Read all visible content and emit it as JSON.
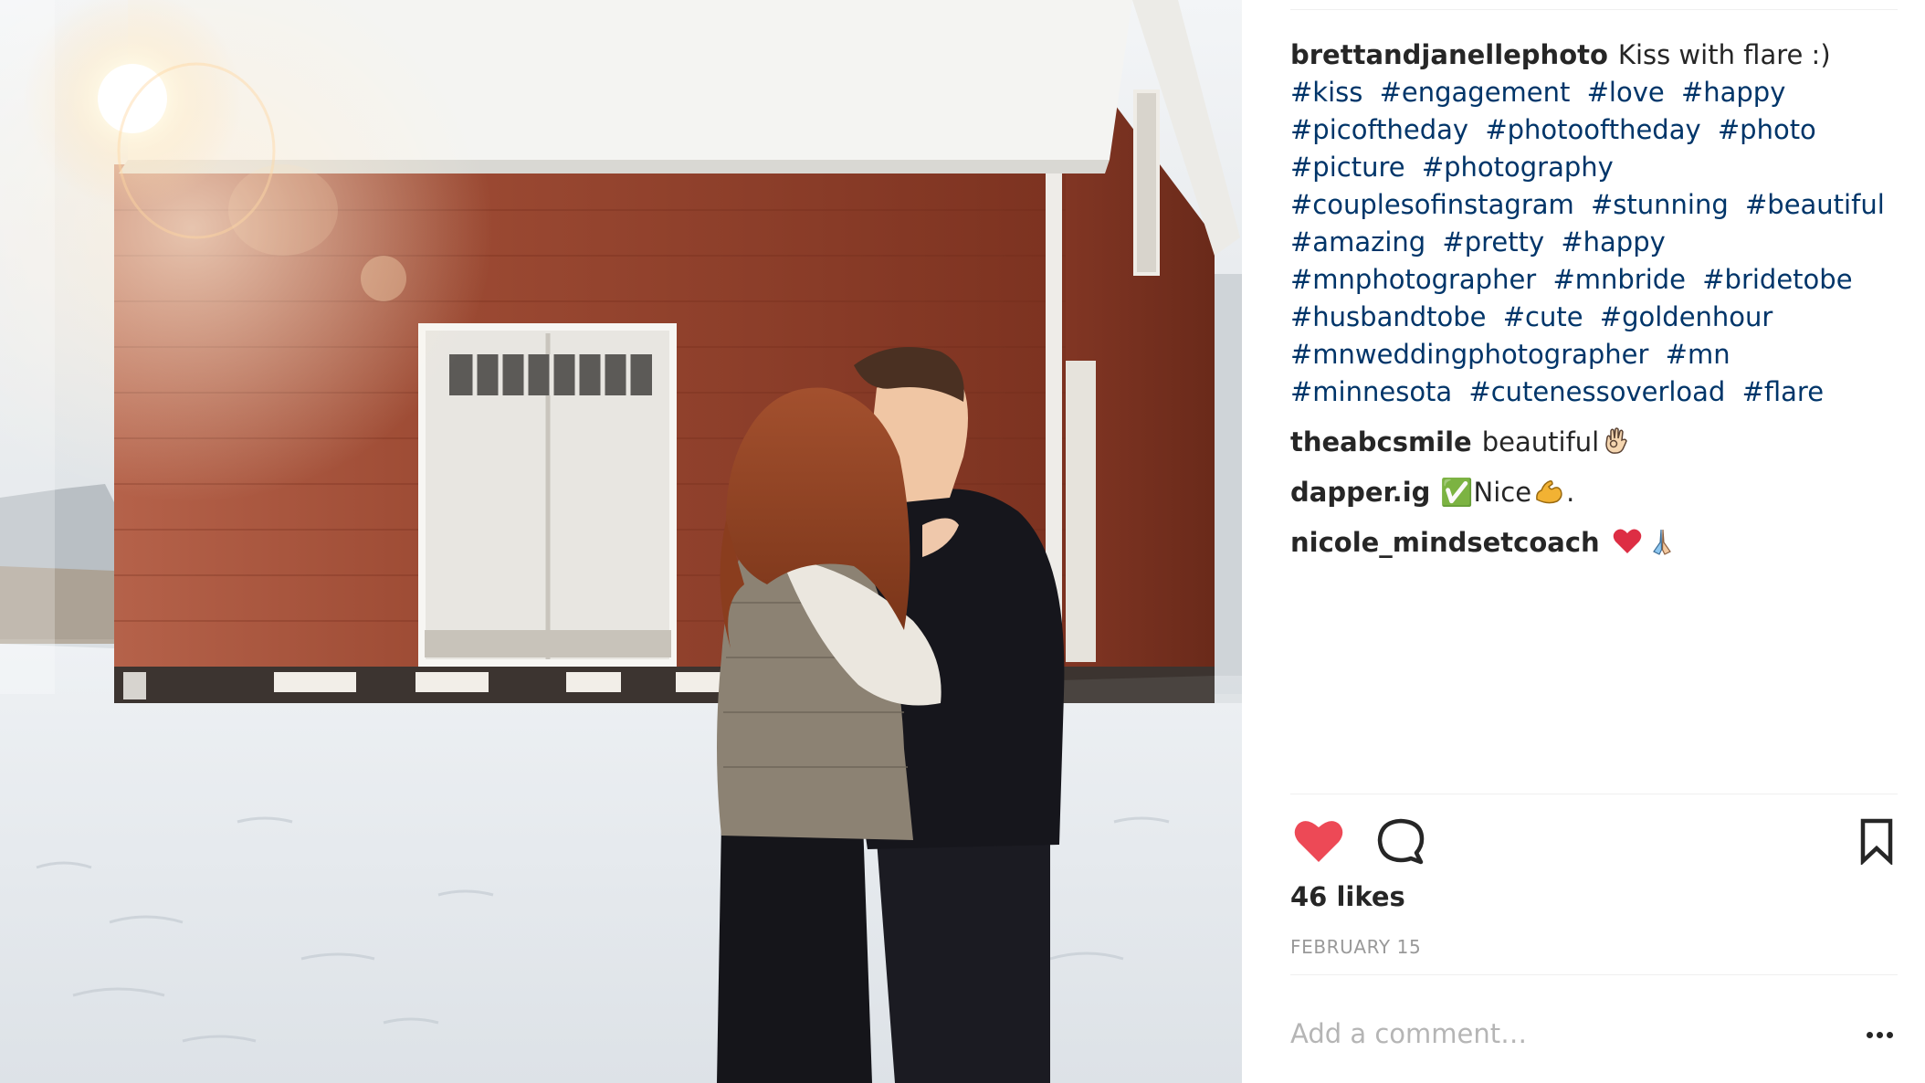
{
  "post": {
    "author": "brettandjanellephoto",
    "caption_text": "Kiss with flare :)",
    "hashtags": [
      "#kiss",
      "#engagement",
      "#love",
      "#happy",
      "#picoftheday",
      "#photooftheday",
      "#photo",
      "#picture",
      "#photography",
      "#couplesofinstagram",
      "#stunning",
      "#beautiful",
      "#amazing",
      "#pretty",
      "#happy",
      "#mnphotographer",
      "#mnbride",
      "#bridetobe",
      "#husbandtobe",
      "#cute",
      "#goldenhour",
      "#mnweddingphotographer",
      "#mn",
      "#minnesota",
      "#cutenessoverload",
      "#flare"
    ],
    "photo_alt": "Couple kissing in front of a red barn in the snow with sun flare",
    "hashtag_color": "#003569"
  },
  "comments": [
    {
      "user": "theabcsmile",
      "text": "beautiful",
      "emojis": [
        "ok-hand-icon"
      ]
    },
    {
      "user": "dapper.ig",
      "text_before": "✅Nice",
      "text_after": ".",
      "emojis": [
        "flexed-biceps-icon"
      ]
    },
    {
      "user": "nicole_mindsetcoach",
      "text": "",
      "emojis": [
        "red-heart-icon",
        "folded-hands-icon"
      ]
    }
  ],
  "actions": {
    "like_icon": "heart-filled-icon",
    "like_color": "#ed4956",
    "comment_icon": "speech-bubble-icon",
    "save_icon": "bookmark-icon"
  },
  "likes": {
    "text": "46 likes"
  },
  "date": {
    "text": "FEBRUARY 15"
  },
  "add_comment": {
    "placeholder": "Add a comment…"
  },
  "more_options_icon": "ellipsis-icon"
}
